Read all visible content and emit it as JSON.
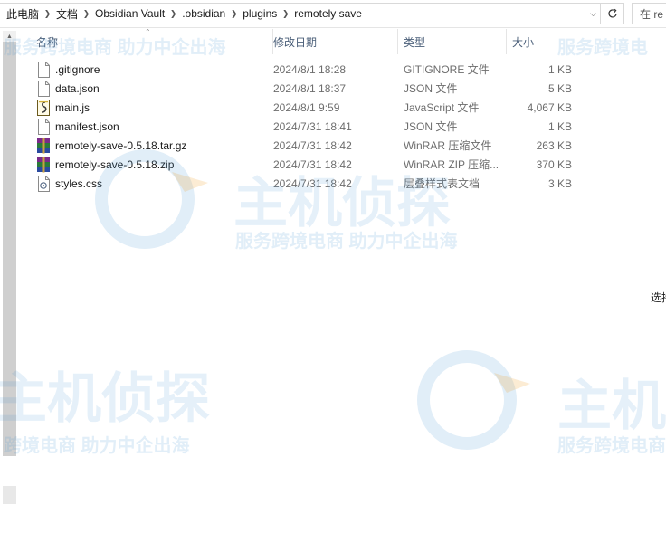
{
  "address_bar": {
    "breadcrumbs": [
      "此电脑",
      "文档",
      "Obsidian Vault",
      ".obsidian",
      "plugins",
      "remotely save"
    ],
    "search_placeholder": "在 re"
  },
  "columns": {
    "name": "名称",
    "date": "修改日期",
    "type": "类型",
    "size": "大小"
  },
  "files": [
    {
      "name": ".gitignore",
      "date": "2024/8/1 18:28",
      "type": "GITIGNORE 文件",
      "size": "1 KB",
      "icon": "blank-file-icon"
    },
    {
      "name": "data.json",
      "date": "2024/8/1 18:37",
      "type": "JSON 文件",
      "size": "5 KB",
      "icon": "blank-file-icon"
    },
    {
      "name": "main.js",
      "date": "2024/8/1 9:59",
      "type": "JavaScript 文件",
      "size": "4,067 KB",
      "icon": "script-file-icon"
    },
    {
      "name": "manifest.json",
      "date": "2024/7/31 18:41",
      "type": "JSON 文件",
      "size": "1 KB",
      "icon": "blank-file-icon"
    },
    {
      "name": "remotely-save-0.5.18.tar.gz",
      "date": "2024/7/31 18:42",
      "type": "WinRAR 压缩文件",
      "size": "263 KB",
      "icon": "winrar-archive-icon"
    },
    {
      "name": "remotely-save-0.5.18.zip",
      "date": "2024/7/31 18:42",
      "type": "WinRAR ZIP 压缩...",
      "size": "370 KB",
      "icon": "winrar-archive-icon"
    },
    {
      "name": "styles.css",
      "date": "2024/7/31 18:42",
      "type": "层叠样式表文档",
      "size": "3 KB",
      "icon": "stylesheet-file-icon"
    }
  ],
  "details_pane_hint": "选持",
  "watermark": {
    "tagline": "服务跨境电商 助力中企出海",
    "tagline_right": "服务跨境电",
    "logo_text": "主机侦探",
    "logo_text_partial": "主机",
    "tagline_partial": "跨境电商 助力中企出海",
    "tagline_right_partial": "服务跨境电商"
  },
  "colors": {
    "header_text": "#4c607a",
    "secondary_text": "#6d6d6d",
    "watermark": "#4696d2"
  }
}
